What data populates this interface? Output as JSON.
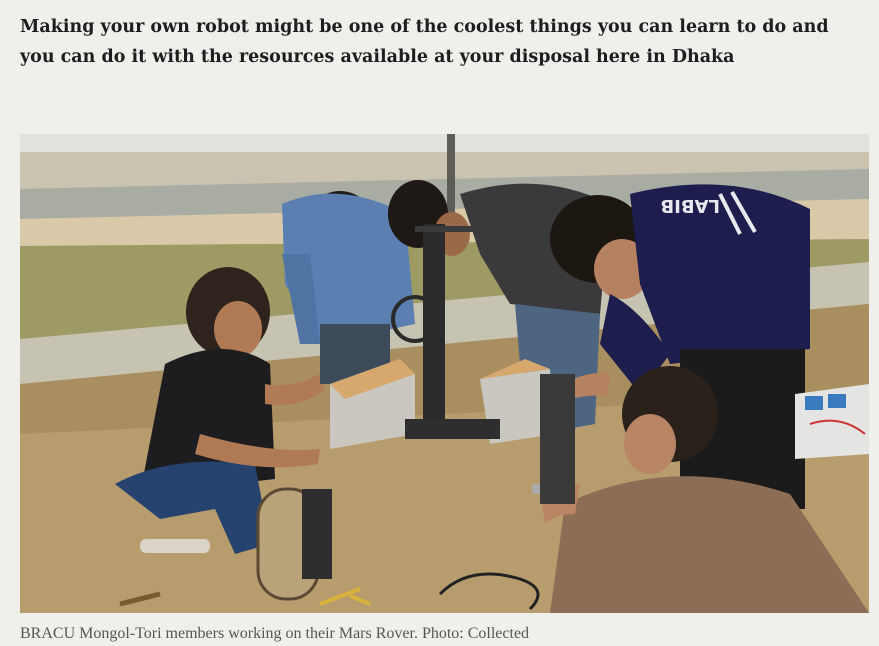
{
  "article": {
    "lead": "Making your own robot might be one of the coolest things you can learn to do and you can do it with the resources available at your disposal here in Dhaka",
    "figure": {
      "jersey_text": "LABIB",
      "caption": "BRACU Mongol-Tori members working on their Mars Rover. Photo: Collected"
    }
  }
}
